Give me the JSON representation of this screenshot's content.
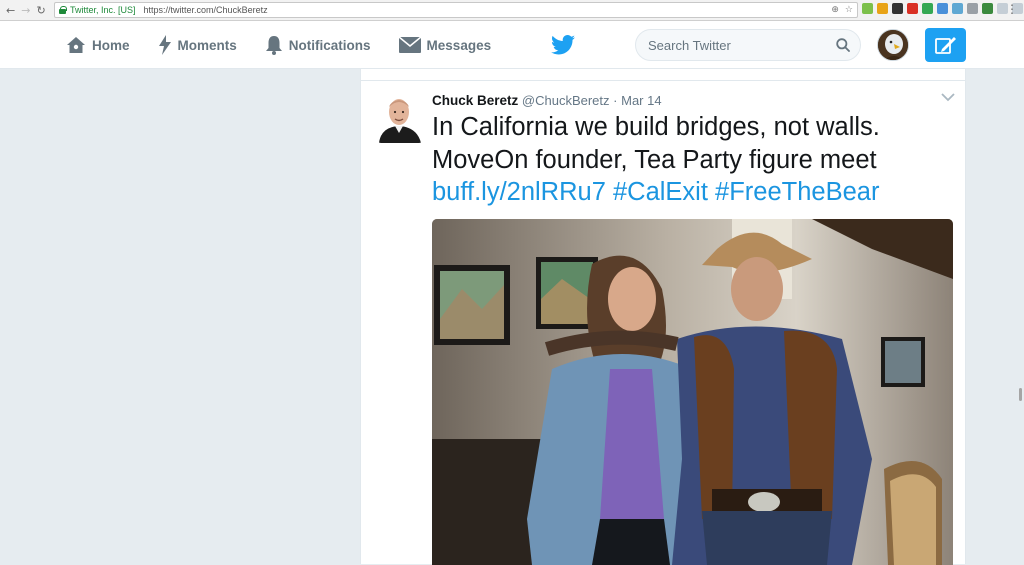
{
  "browser": {
    "back_icon": "back-arrow-icon",
    "forward_icon": "forward-arrow-icon",
    "reload_icon": "reload-icon",
    "secure_label": "Twitter, Inc. [US]",
    "url": "https://twitter.com/ChuckBeretz"
  },
  "nav": {
    "home": "Home",
    "moments": "Moments",
    "notifications": "Notifications",
    "messages": "Messages"
  },
  "search": {
    "placeholder": "Search Twitter"
  },
  "colors": {
    "brand": "#1da1f2",
    "link": "#1b95e0",
    "text": "#14171a",
    "muted": "#657786"
  },
  "tweet": {
    "name": "Chuck Beretz",
    "handle": "@ChuckBeretz",
    "separator": "·",
    "date": "Mar 14",
    "line1": "In California we build bridges, not walls.",
    "line2": "MoveOn founder, Tea Party figure meet",
    "link": "buff.ly/2nlRRu7",
    "hashtag1": "#CalExit",
    "hashtag2": "#FreeTheBear"
  }
}
